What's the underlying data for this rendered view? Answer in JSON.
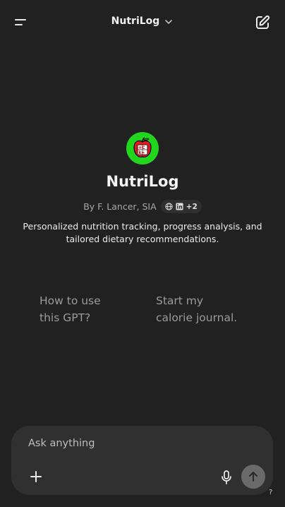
{
  "header": {
    "title": "NutriLog"
  },
  "gpt": {
    "name": "NutriLog",
    "byline": "By F. Lancer, SIA",
    "social_more": "+2",
    "description": "Personalized nutrition tracking, progress analysis, and tailored dietary recommendations.",
    "logo_text_top": "+C",
    "logo_text_bottom": "k=",
    "logo_color": "#22d61e"
  },
  "starters": [
    {
      "label": "How to use\nthis GPT?"
    },
    {
      "label": "Start my\ncalorie journal."
    }
  ],
  "composer": {
    "placeholder": "Ask anything"
  },
  "help_label": "?",
  "colors": {
    "background": "#212121",
    "composer": "#303030",
    "send_button": "#6a6a6a"
  },
  "icons": [
    "menu-icon",
    "chevron-down-icon",
    "edit-icon",
    "globe-icon",
    "linkedin-icon",
    "plus-icon",
    "mic-icon",
    "arrow-up-icon"
  ]
}
